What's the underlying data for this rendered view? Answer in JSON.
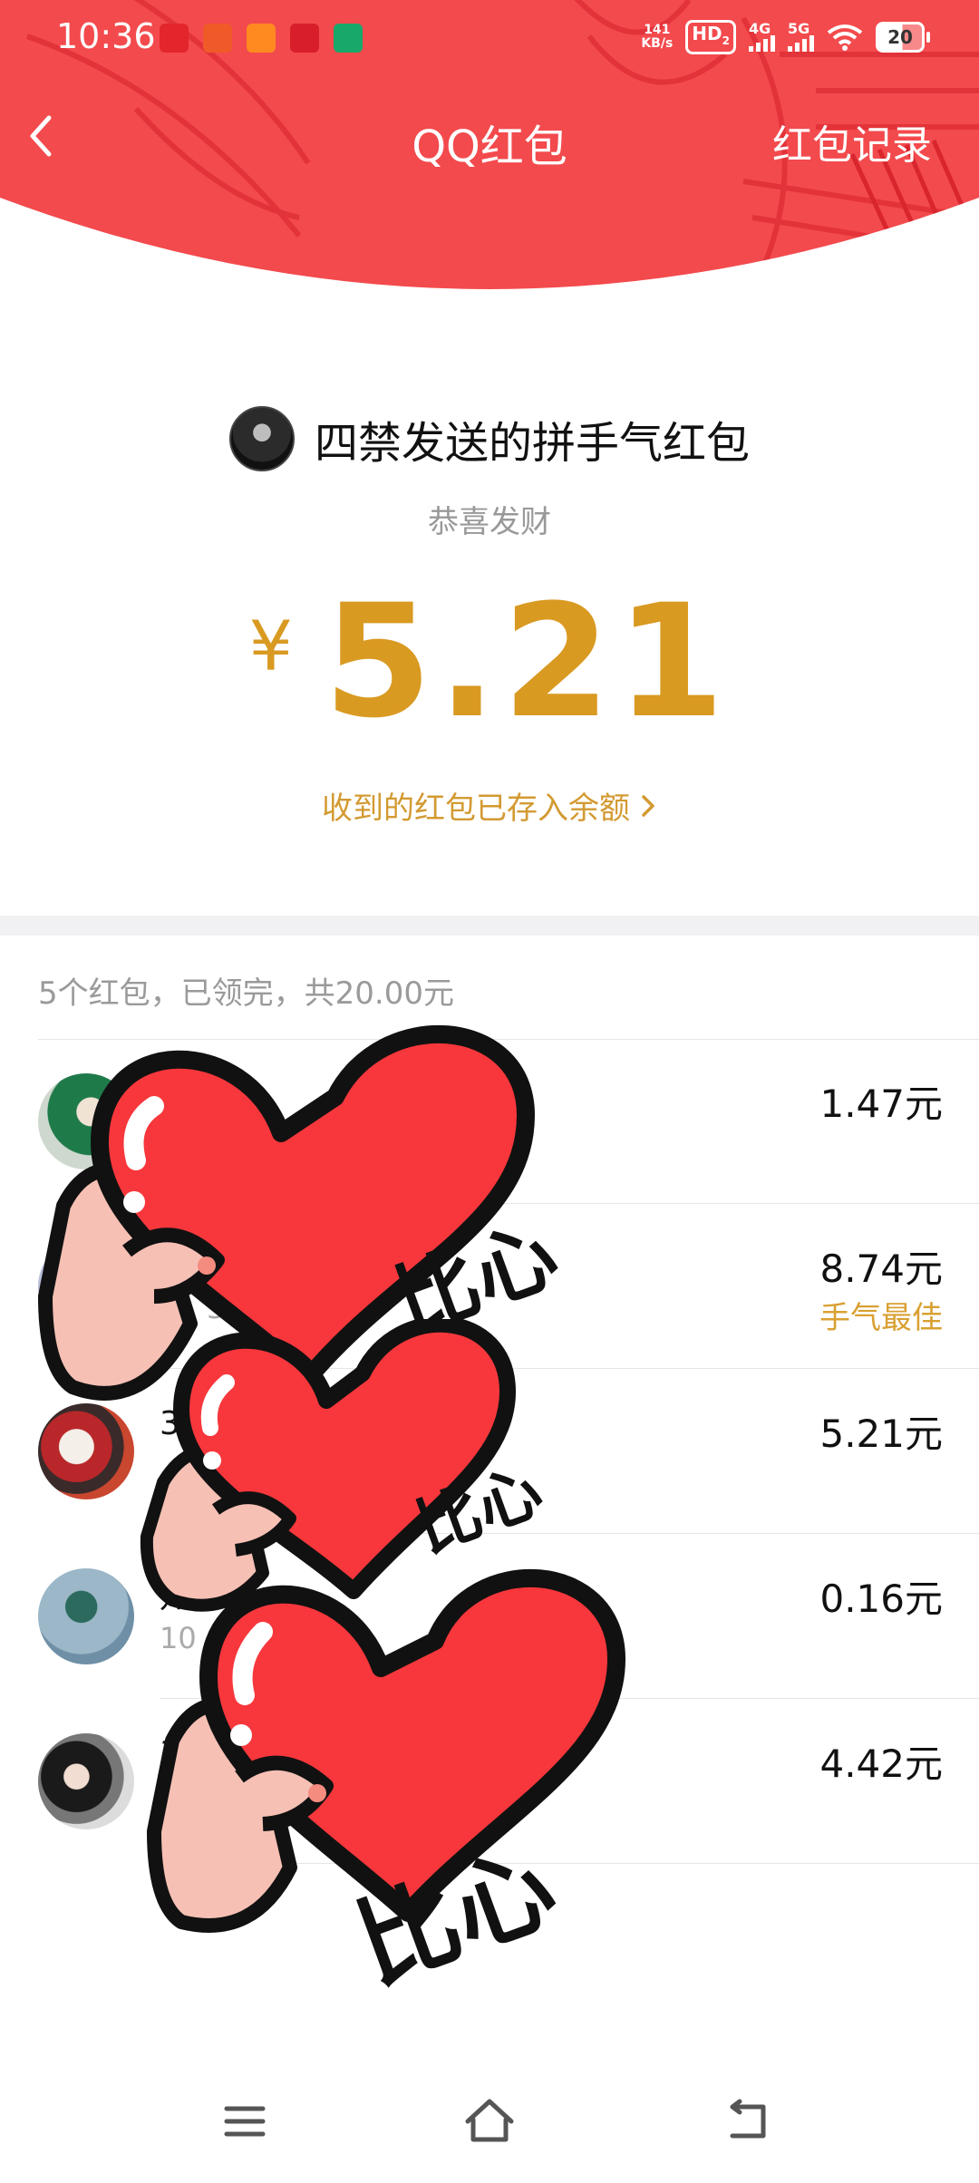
{
  "status_bar": {
    "time": "10:36",
    "net_speed_value": "141",
    "net_speed_unit": "KB/s",
    "hd_label": "HD",
    "hd_sub": "2",
    "sig1_label": "4G",
    "sig2_label": "5G",
    "battery_level": "20",
    "colors": {
      "bg": "#f34a4d"
    }
  },
  "nav": {
    "title": "QQ红包",
    "records_label": "红包记录",
    "back_icon": "chevron-left-icon"
  },
  "summary": {
    "sender_title": "四禁发送的拼手气红包",
    "wish_text": "恭喜发财",
    "currency_symbol": "¥",
    "amount": "5.21",
    "balance_link": "收到的红包已存入余额",
    "accent_color": "#d99a22"
  },
  "list": {
    "summary_text": "5个红包，已领完，共20.00元",
    "rows": [
      {
        "name": "",
        "time": "",
        "amount": "1.47元",
        "best": ""
      },
      {
        "name": "",
        "time": "32-0",
        "amount": "8.74元",
        "best": "手气最佳"
      },
      {
        "name": "3",
        "time": "",
        "amount": "5.21元",
        "best": ""
      },
      {
        "name": "知意",
        "time": "10",
        "amount": "0.16元",
        "best": ""
      },
      {
        "name": "3",
        "time": "",
        "amount": "4.42元",
        "best": ""
      }
    ]
  },
  "stickers": {
    "caption": "比心"
  },
  "system_nav": {
    "menu_icon": "menu-icon",
    "home_icon": "home-icon",
    "back_icon": "back-icon"
  }
}
